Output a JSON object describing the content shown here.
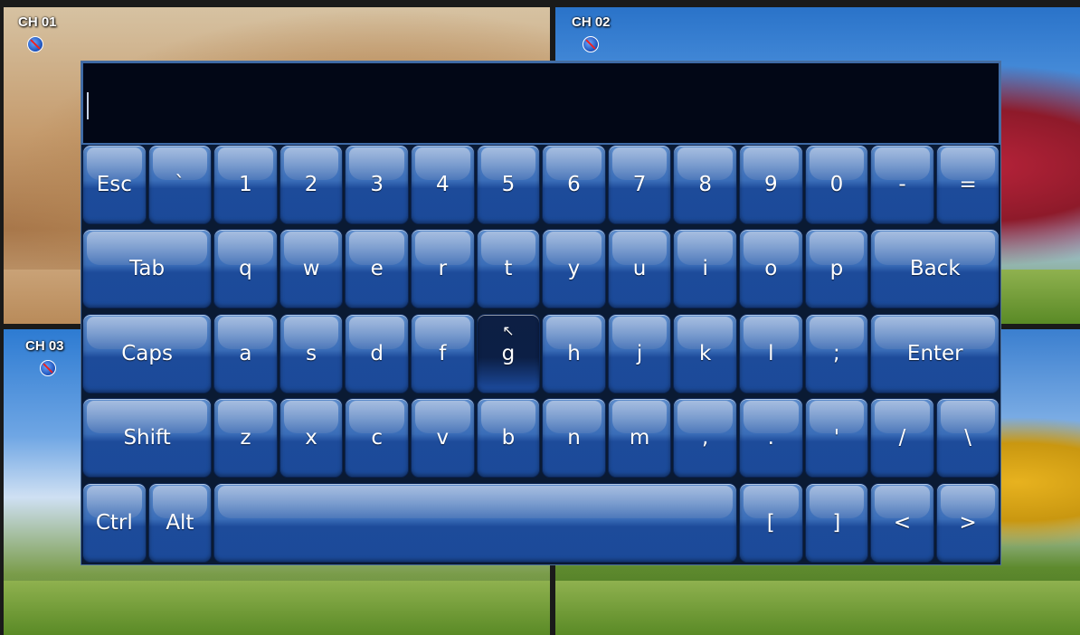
{
  "channels": [
    {
      "label": "CH 01",
      "icon": "record-off-icon"
    },
    {
      "label": "CH 02",
      "icon": "record-off-icon"
    },
    {
      "label": "CH 03",
      "icon": "record-off-icon"
    }
  ],
  "input": {
    "value": ""
  },
  "keyboard": {
    "row1": [
      "Esc",
      "`",
      "1",
      "2",
      "3",
      "4",
      "5",
      "6",
      "7",
      "8",
      "9",
      "0",
      "-",
      "="
    ],
    "row2": [
      "Tab",
      "q",
      "w",
      "e",
      "r",
      "t",
      "y",
      "u",
      "i",
      "o",
      "p",
      "Back"
    ],
    "row3": [
      "Caps",
      "a",
      "s",
      "d",
      "f",
      "g",
      "h",
      "j",
      "k",
      "l",
      ";",
      "Enter"
    ],
    "row4": [
      "Shift",
      "z",
      "x",
      "c",
      "v",
      "b",
      "n",
      "m",
      ",",
      ".",
      "'",
      "/",
      "\\"
    ],
    "row5": [
      "Ctrl",
      "Alt",
      "",
      "[",
      "]",
      "<",
      ">"
    ],
    "active_key": "g",
    "colors": {
      "key": "#2d5fb0",
      "active_key": "#0c1f45",
      "input_bg": "#020716"
    }
  }
}
